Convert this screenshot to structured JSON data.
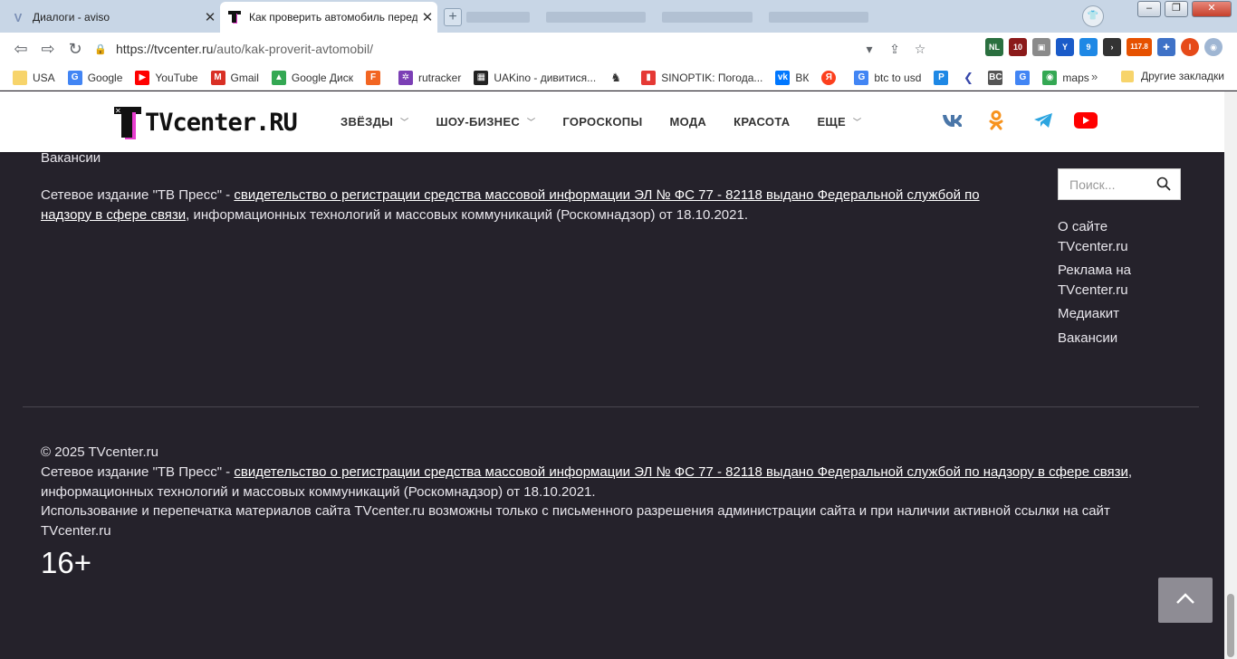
{
  "browser": {
    "tabs": [
      {
        "title": "Диалоги - aviso",
        "icon": "v-icon"
      },
      {
        "title": "Как проверить автомобиль перед",
        "icon": "tvcenter-favicon"
      }
    ],
    "url_host": "https://tvcenter.ru",
    "url_path": "/auto/kak-proverit-avtomobil/",
    "extension_badges": [
      "NL",
      "10",
      "9",
      "117.8"
    ],
    "profile_initial": "I"
  },
  "bookmarks": {
    "items": [
      {
        "label": "USA",
        "color": "#f7d46b"
      },
      {
        "label": "Google",
        "color": "#4285f4"
      },
      {
        "label": "YouTube",
        "color": "#ff0000"
      },
      {
        "label": "Gmail",
        "color": "#d93025"
      },
      {
        "label": "Google Диск",
        "color": "#34a853"
      },
      {
        "label": "",
        "color": "#f26522"
      },
      {
        "label": "rutracker",
        "color": "#7b3fb5"
      },
      {
        "label": "UAKino - дивитися...",
        "color": "#222222"
      },
      {
        "label": "",
        "color": "#333333"
      },
      {
        "label": "SINOPTIK: Погода...",
        "color": "#e53935"
      },
      {
        "label": "ВК",
        "color": "#0077ff"
      },
      {
        "label": "",
        "color": "#fc3f1d"
      },
      {
        "label": "btc to usd",
        "color": "#4285f4"
      },
      {
        "label": "",
        "color": "#1e88e5"
      },
      {
        "label": "",
        "color": "#3949ab"
      },
      {
        "label": "",
        "color": "#555555"
      },
      {
        "label": "",
        "color": "#4285f4"
      },
      {
        "label": "maps",
        "color": "#34a853"
      }
    ],
    "more": "»",
    "other": "Другие закладки"
  },
  "site": {
    "logo_text": "TVcenter.RU",
    "nav": [
      {
        "label": "ЗВЁЗДЫ",
        "dropdown": true
      },
      {
        "label": "ШОУ-БИЗНЕС",
        "dropdown": true
      },
      {
        "label": "ГОРОСКОПЫ",
        "dropdown": false
      },
      {
        "label": "МОДА",
        "dropdown": false
      },
      {
        "label": "КРАСОТА",
        "dropdown": false
      },
      {
        "label": "ЕЩЕ",
        "dropdown": true
      }
    ],
    "social_colors": {
      "vk": "#4a76a8",
      "ok": "#f7931e",
      "telegram": "#2ca5e0",
      "youtube": "#ff0000"
    }
  },
  "footer": {
    "top_link": "Вакансии",
    "reg_prefix": "Сетевое издание \"ТВ Пресс\" - ",
    "reg_link": "свидетельство о регистрации средства массовой информации ЭЛ № ФС 77 - 82118 выдано Федеральной службой по надзору в сфере связи",
    "reg_suffix": ", информационных технологий и массовых коммуникаций (Роскомнадзор) от 18.10.2021.",
    "search_placeholder": "Поиск...",
    "side_links": [
      "О сайте TVcenter.ru",
      "Реклама на TVcenter.ru",
      "Медиакит",
      "Вакансии"
    ],
    "copyright": "© 2025 TVcenter.ru",
    "usage": "Использование и перепечатка материалов сайта TVcenter.ru возможны только с письменного разрешения администрации сайта и при наличии активной ссылки на сайт TVcenter.ru",
    "age_rating": "16+"
  }
}
